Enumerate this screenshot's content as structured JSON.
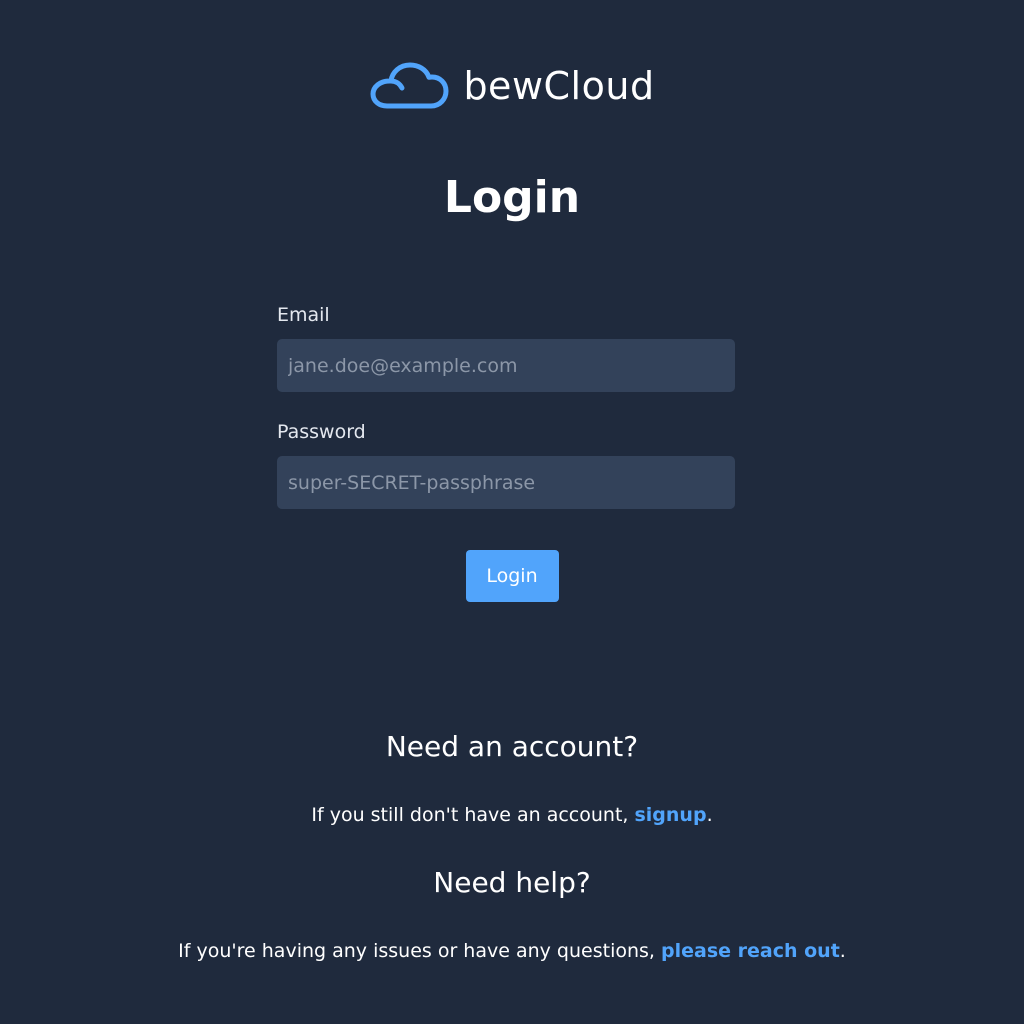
{
  "brand": {
    "name": "bewCloud",
    "logo_icon": "cloud-icon",
    "accent_color": "#51a4fb"
  },
  "page": {
    "title": "Login"
  },
  "form": {
    "email": {
      "label": "Email",
      "placeholder": "jane.doe@example.com",
      "value": ""
    },
    "password": {
      "label": "Password",
      "placeholder": "super-SECRET-passphrase",
      "value": ""
    },
    "submit_label": "Login"
  },
  "signup_section": {
    "heading": "Need an account?",
    "text_before": "If you still don't have an account, ",
    "link_label": "signup",
    "text_after": "."
  },
  "help_section": {
    "heading": "Need help?",
    "text_before": "If you're having any issues or have any questions, ",
    "link_label": "please reach out",
    "text_after": "."
  }
}
